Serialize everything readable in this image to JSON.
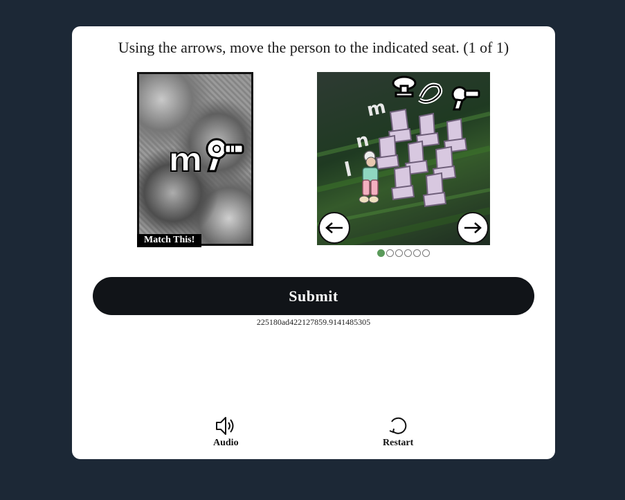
{
  "instruction": "Using the arrows, move the person to the indicated seat. (1 of 1)",
  "reference": {
    "label": "Match This!",
    "letter": "m"
  },
  "scene": {
    "row_letters": [
      "m",
      "n",
      "l"
    ],
    "pagination": {
      "total": 6,
      "active": 1
    }
  },
  "submit_label": "Submit",
  "session_id": "225180ad422127859.9141485305",
  "tools": {
    "audio_label": "Audio",
    "restart_label": "Restart"
  },
  "colors": {
    "page_bg": "#1c2836",
    "card_bg": "#ffffff",
    "submit_bg": "#111418",
    "active_dot": "#5a9a5a"
  }
}
